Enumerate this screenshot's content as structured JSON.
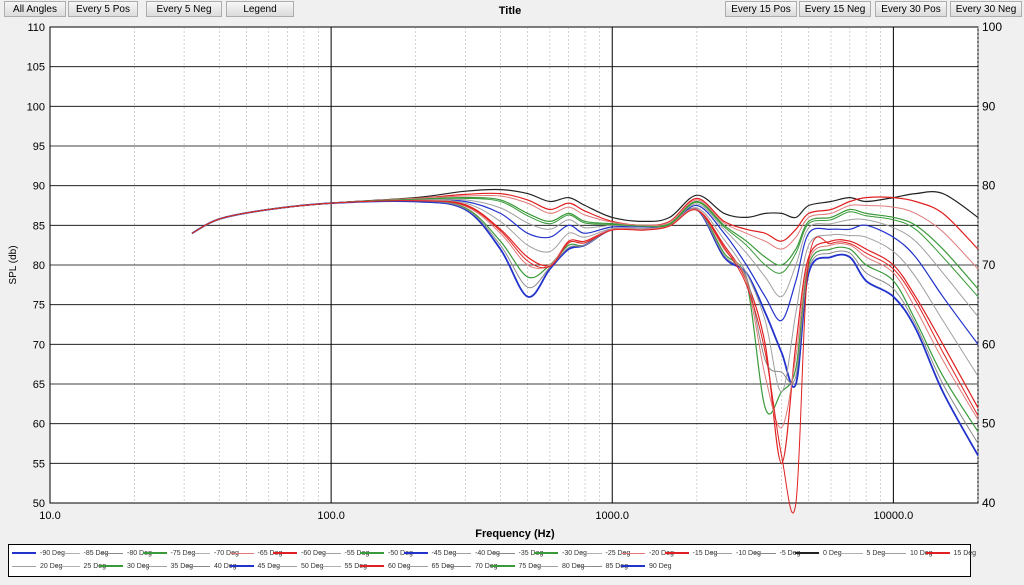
{
  "toolbar": {
    "left": [
      "All Angles",
      "Every 5 Pos",
      "Every 5 Neg",
      "Legend"
    ],
    "right": [
      "Every 15 Pos",
      "Every 15 Neg",
      "Every 30 Pos",
      "Every 30 Neg"
    ]
  },
  "chart_data": {
    "type": "line",
    "title": "Title",
    "xlabel": "Frequency (Hz)",
    "ylabel": "SPL (db)",
    "x_scale": "log",
    "xlim": [
      10,
      20000
    ],
    "ylim": [
      50,
      110
    ],
    "y2lim": [
      40,
      100
    ],
    "grid": true,
    "x_ticks": [
      "10.0",
      "100.0",
      "1000.0",
      "10000.0"
    ],
    "y_ticks": [
      "50",
      "55",
      "60",
      "65",
      "70",
      "75",
      "80",
      "85",
      "90",
      "95",
      "100",
      "105",
      "110"
    ],
    "y2_ticks": [
      "40",
      "50",
      "60",
      "70",
      "80",
      "90",
      "100"
    ],
    "legend_position": "bottom",
    "legend": [
      {
        "name": "-90 Deg",
        "color": "#2233cc"
      },
      {
        "name": "-85 Deg",
        "color": "#b0b0b0"
      },
      {
        "name": "-80 Deg",
        "color": "#8a8a8a"
      },
      {
        "name": "-75 Deg",
        "color": "#3a9a3a"
      },
      {
        "name": "-70 Deg",
        "color": "#b0b0b0"
      },
      {
        "name": "-65 Deg",
        "color": "#e07a7a"
      },
      {
        "name": "-60 Deg",
        "color": "#e02020"
      },
      {
        "name": "-55 Deg",
        "color": "#a0a0a0"
      },
      {
        "name": "-50 Deg",
        "color": "#3a9a3a"
      },
      {
        "name": "-45 Deg",
        "color": "#2233cc"
      },
      {
        "name": "-40 Deg",
        "color": "#a0a0a0"
      },
      {
        "name": "-35 Deg",
        "color": "#8a8a8a"
      },
      {
        "name": "-30 Deg",
        "color": "#3a9a3a"
      },
      {
        "name": "-25 Deg",
        "color": "#b0b0b0"
      },
      {
        "name": "-20 Deg",
        "color": "#e07a7a"
      },
      {
        "name": "-15 Deg",
        "color": "#e02020"
      },
      {
        "name": "-10 Deg",
        "color": "#a0a0a0"
      },
      {
        "name": "-5 Deg",
        "color": "#8a8a8a"
      },
      {
        "name": "0 Deg",
        "color": "#222222"
      },
      {
        "name": "5 Deg",
        "color": "#b0b0b0"
      },
      {
        "name": "10 Deg",
        "color": "#a0a0a0"
      },
      {
        "name": "15 Deg",
        "color": "#e02020"
      },
      {
        "name": "20 Deg",
        "color": "#a0a0a0"
      },
      {
        "name": "25 Deg",
        "color": "#b0b0b0"
      },
      {
        "name": "30 Deg",
        "color": "#3a9a3a"
      },
      {
        "name": "35 Deg",
        "color": "#a0a0a0"
      },
      {
        "name": "40 Deg",
        "color": "#8a8a8a"
      },
      {
        "name": "45 Deg",
        "color": "#2233cc"
      },
      {
        "name": "50 Deg",
        "color": "#a0a0a0"
      },
      {
        "name": "55 Deg",
        "color": "#b0b0b0"
      },
      {
        "name": "60 Deg",
        "color": "#e02020"
      },
      {
        "name": "65 Deg",
        "color": "#a0a0a0"
      },
      {
        "name": "70 Deg",
        "color": "#8a8a8a"
      },
      {
        "name": "75 Deg",
        "color": "#3a9a3a"
      },
      {
        "name": "80 Deg",
        "color": "#a0a0a0"
      },
      {
        "name": "85 Deg",
        "color": "#8a8a8a"
      },
      {
        "name": "90 Deg",
        "color": "#2233cc"
      }
    ],
    "x": [
      32,
      40,
      60,
      100,
      200,
      300,
      400,
      500,
      600,
      700,
      800,
      1000,
      1300,
      1600,
      2000,
      2500,
      3000,
      3500,
      4000,
      4500,
      5000,
      6000,
      7000,
      8000,
      10000,
      12000,
      15000,
      20000
    ],
    "series": [
      {
        "name": "0 Deg",
        "color": "#222222",
        "width": 1.2,
        "values": [
          84,
          85.8,
          87,
          87.8,
          88.5,
          89.3,
          89.5,
          89,
          88,
          88.5,
          87.5,
          86,
          85.5,
          86,
          88.8,
          86.5,
          86,
          86.5,
          86.5,
          86,
          87.5,
          88,
          88.5,
          88,
          88.5,
          89,
          89,
          86
        ]
      },
      {
        "name": "-15 Deg",
        "color": "#e02020",
        "width": 1.2,
        "values": [
          84,
          85.8,
          87,
          87.8,
          88.4,
          88.9,
          89,
          88.2,
          87,
          87.8,
          86.8,
          85.5,
          85,
          85.5,
          88.4,
          85.5,
          84.5,
          84,
          83,
          84.5,
          86.5,
          87,
          88,
          88.5,
          88.5,
          88,
          86.5,
          82
        ]
      },
      {
        "name": "-30 Deg",
        "color": "#3a9a3a",
        "width": 1.2,
        "values": [
          84,
          85.8,
          87,
          87.8,
          88.3,
          88.5,
          88.2,
          86.5,
          85.5,
          86.5,
          85.5,
          85.2,
          85,
          85.2,
          88,
          85,
          83,
          81,
          80,
          82,
          85.5,
          86,
          87,
          86.5,
          86,
          85,
          82,
          77
        ]
      },
      {
        "name": "-45 Deg",
        "color": "#2233cc",
        "width": 1.2,
        "values": [
          84,
          85.8,
          87,
          87.8,
          88.2,
          88,
          86.5,
          84,
          83.5,
          85,
          84,
          84.8,
          84.8,
          85,
          87.5,
          84,
          80,
          76,
          73,
          78,
          84,
          84.5,
          84.5,
          85,
          83.5,
          81,
          76,
          70
        ]
      },
      {
        "name": "-60 Deg",
        "color": "#e02020",
        "width": 1.2,
        "values": [
          84,
          85.8,
          87,
          87.8,
          88.2,
          87.6,
          84.5,
          81,
          80,
          83,
          83,
          84.5,
          84.5,
          85,
          87,
          82.5,
          78,
          70,
          55,
          70,
          81,
          83,
          83,
          82,
          80,
          76,
          70,
          62
        ]
      },
      {
        "name": "-75 Deg",
        "color": "#3a9a3a",
        "width": 1.2,
        "values": [
          84,
          85.8,
          87,
          87.8,
          88.1,
          87.2,
          83,
          78.5,
          80,
          82.5,
          82.5,
          84.5,
          84.5,
          85,
          87,
          81.5,
          78,
          62,
          64,
          67,
          80,
          82,
          82,
          80,
          78,
          73,
          66,
          59
        ]
      },
      {
        "name": "-90 Deg",
        "color": "#2233cc",
        "width": 1.8,
        "values": [
          84,
          85.8,
          87,
          87.8,
          88,
          87,
          82,
          76,
          79.5,
          82,
          82.5,
          84.5,
          84.5,
          85,
          87,
          81,
          79,
          74,
          69,
          65,
          79,
          81,
          81,
          78,
          76,
          72,
          64,
          56
        ]
      },
      {
        "name": "-40 Deg",
        "color": "#a0a0a0",
        "width": 1,
        "values": [
          84,
          85.8,
          87,
          87.8,
          88.2,
          88.2,
          87.2,
          85.3,
          84.5,
          85.7,
          84.7,
          85,
          84.9,
          85.1,
          87.7,
          84.5,
          81.5,
          78.5,
          76,
          80,
          84.7,
          85.2,
          85.7,
          85.7,
          84.7,
          83,
          79,
          73.5
        ]
      },
      {
        "name": "-55 Deg",
        "color": "#a0a0a0",
        "width": 1,
        "values": [
          84,
          85.8,
          87,
          87.8,
          88.2,
          87.8,
          85.5,
          82.5,
          81.7,
          84,
          83.5,
          84.6,
          84.6,
          85,
          87.2,
          83.2,
          79,
          73,
          64,
          74,
          82.5,
          83.8,
          83.7,
          83.5,
          81.7,
          78.5,
          73,
          66
        ]
      },
      {
        "name": "-80 Deg",
        "color": "#8a8a8a",
        "width": 1,
        "values": [
          84,
          85.8,
          87,
          87.8,
          88.1,
          87.1,
          82.5,
          77.2,
          79.7,
          82.2,
          82.5,
          84.5,
          84.5,
          85,
          87,
          81.2,
          78.5,
          68,
          66.5,
          66,
          79.5,
          81.5,
          81.5,
          79,
          77,
          72.5,
          65,
          57.5
        ]
      },
      {
        "name": "-20 Deg",
        "color": "#e07a7a",
        "width": 1,
        "values": [
          84,
          85.8,
          87,
          87.8,
          88.4,
          88.7,
          88.7,
          87.8,
          86.5,
          87.3,
          86.3,
          85.4,
          85,
          85.4,
          88.2,
          85.3,
          84,
          83,
          82,
          83.5,
          86,
          86.5,
          87.5,
          87.5,
          87.3,
          86.5,
          84.2,
          79.5
        ]
      },
      {
        "name": "-65 Deg",
        "color": "#e07a7a",
        "width": 1,
        "values": [
          84,
          85.8,
          87,
          87.8,
          88.2,
          87.4,
          84,
          80,
          80,
          82.8,
          82.8,
          84.5,
          84.5,
          85,
          87,
          82,
          78,
          66,
          59.5,
          68.5,
          80.5,
          82.5,
          82.5,
          81,
          79,
          74.5,
          68,
          60.5
        ]
      },
      {
        "name": "30 Deg",
        "color": "#3a9a3a",
        "width": 1,
        "values": [
          84,
          85.8,
          87,
          87.8,
          88.3,
          88.4,
          88,
          86.2,
          85.2,
          86.3,
          85.3,
          85.1,
          84.9,
          85.1,
          87.9,
          84.8,
          82.5,
          80,
          79,
          81.5,
          85.2,
          85.7,
          86.7,
          86.2,
          85.7,
          84.5,
          81,
          76
        ]
      },
      {
        "name": "60 Deg",
        "color": "#e02020",
        "width": 1,
        "values": [
          84,
          85.8,
          87,
          87.8,
          88.1,
          87.5,
          84.3,
          80.5,
          79.8,
          82.8,
          82.8,
          84.4,
          84.4,
          84.9,
          86.9,
          82.2,
          77.5,
          69,
          56,
          50,
          80.5,
          82.7,
          82.7,
          81.5,
          79.5,
          75.5,
          69,
          61
        ]
      }
    ]
  }
}
